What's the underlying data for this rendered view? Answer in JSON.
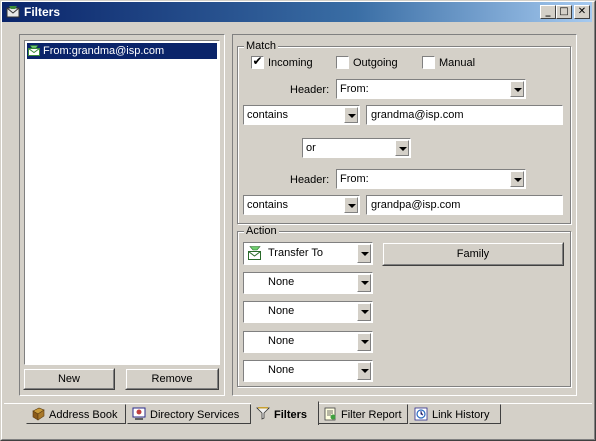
{
  "window": {
    "title": "Filters",
    "controls": {
      "minimize": "_",
      "maximize": "□",
      "close": "✕"
    }
  },
  "filter_list": {
    "items": [
      {
        "label": "From:grandma@isp.com",
        "selected": true
      }
    ],
    "new_label": "New",
    "remove_label": "Remove"
  },
  "match": {
    "group_label": "Match",
    "incoming": {
      "label": "Incoming",
      "checked": true
    },
    "outgoing": {
      "label": "Outgoing",
      "checked": false
    },
    "manual": {
      "label": "Manual",
      "checked": false
    },
    "rule1": {
      "header_label": "Header:",
      "header_value": "From:",
      "operator": "contains",
      "value": "grandma@isp.com"
    },
    "combinator": "or",
    "rule2": {
      "header_label": "Header:",
      "header_value": "From:",
      "operator": "contains",
      "value": "grandpa@isp.com"
    }
  },
  "action": {
    "group_label": "Action",
    "actions": [
      "Transfer To",
      "None",
      "None",
      "None",
      "None"
    ],
    "target_button": "Family"
  },
  "tabs": [
    {
      "label": "Address Book",
      "icon": "address-book-icon",
      "active": false
    },
    {
      "label": "Directory Services",
      "icon": "directory-services-icon",
      "active": false
    },
    {
      "label": "Filters",
      "icon": "filters-icon",
      "active": true
    },
    {
      "label": "Filter Report",
      "icon": "filter-report-icon",
      "active": false
    },
    {
      "label": "Link History",
      "icon": "link-history-icon",
      "active": false
    }
  ],
  "colors": {
    "face": "#d4d0c8",
    "title_start": "#0a246a",
    "title_end": "#a6caf0",
    "selection": "#0a246a"
  }
}
